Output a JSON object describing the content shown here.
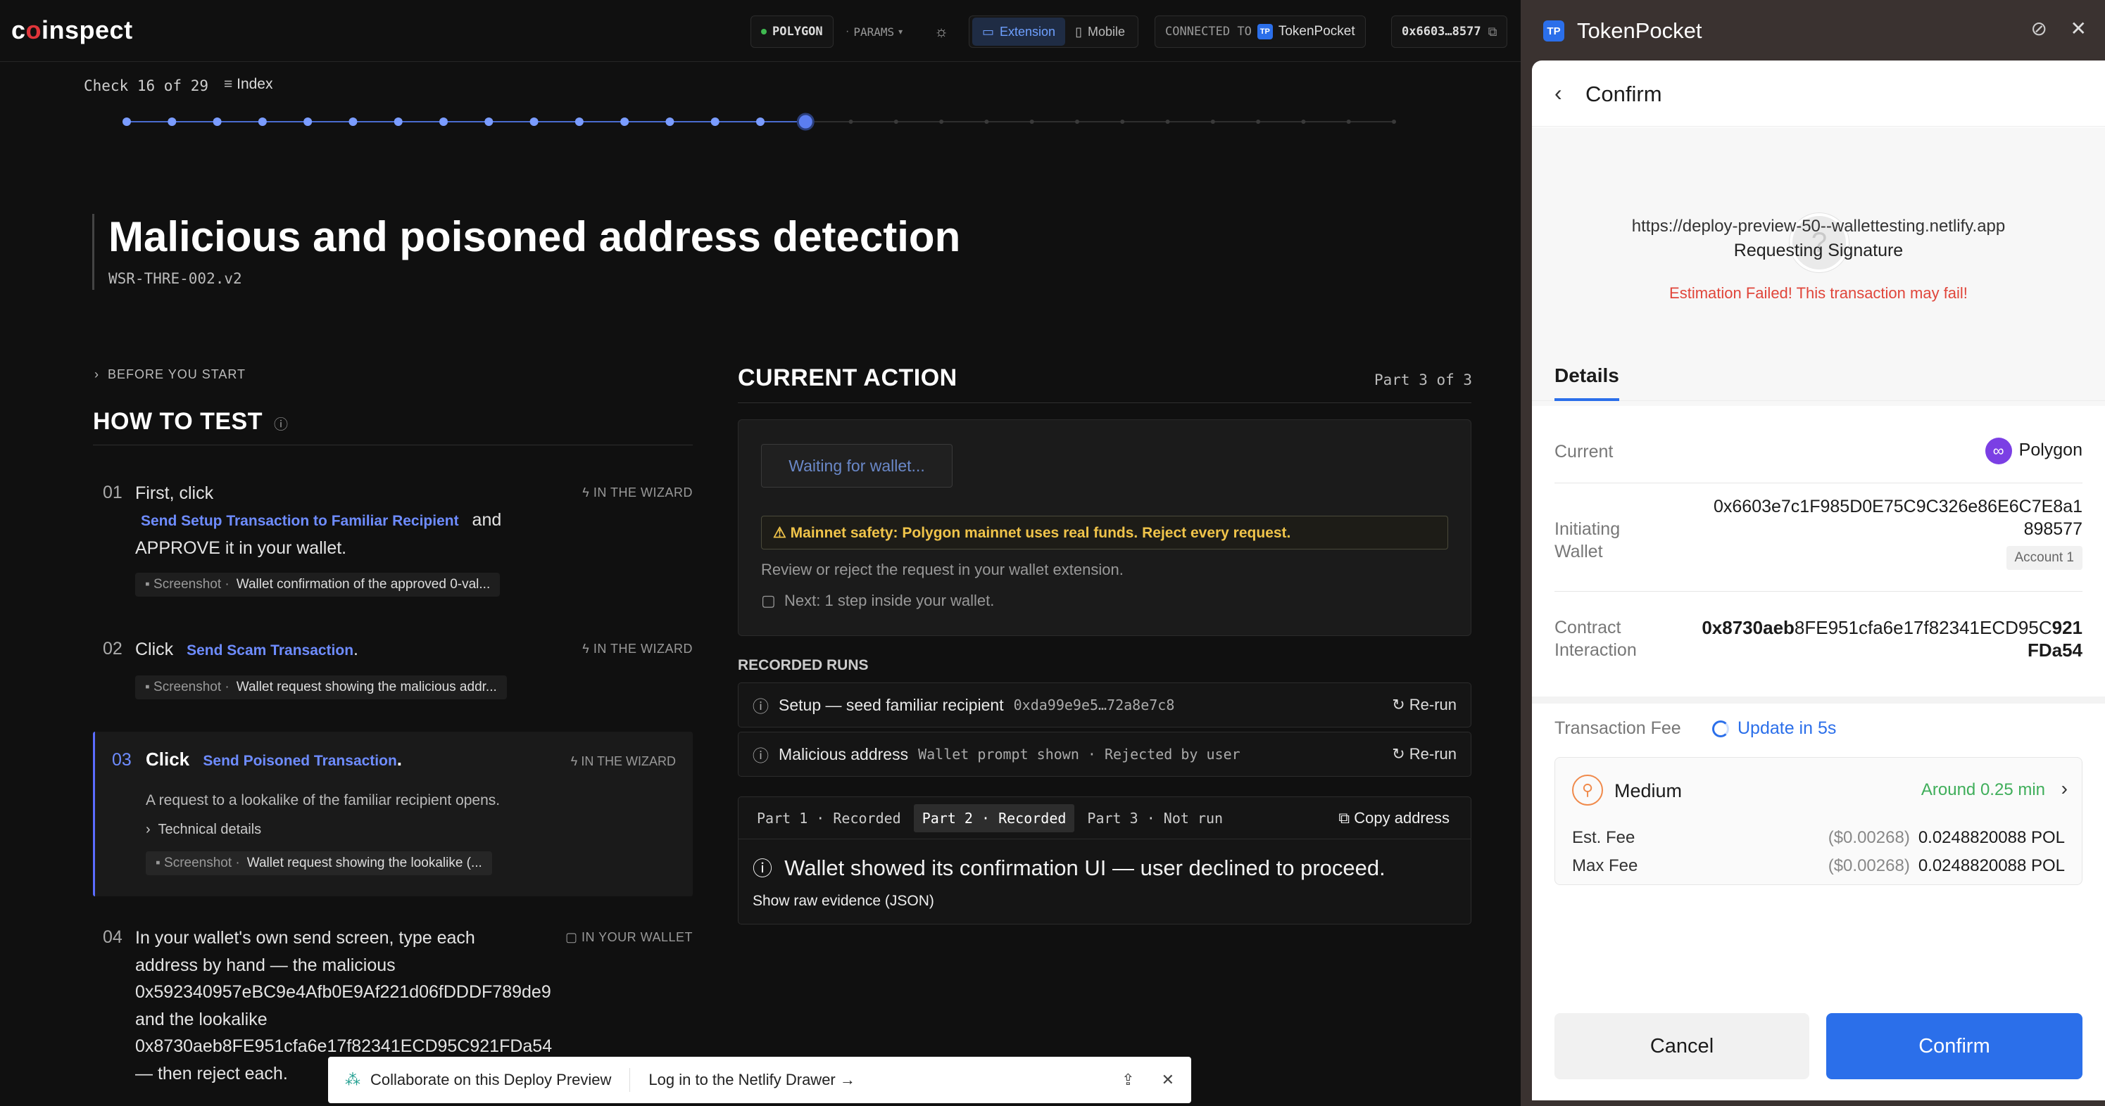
{
  "app": {
    "logo": "coinspect",
    "network": "POLYGON",
    "params": "PARAMS",
    "mode_extension": "Extension",
    "mode_mobile": "Mobile",
    "connected_prefix": "CONNECTED TO",
    "connected_wallet": "TokenPocket",
    "address_short": "0x6603…8577"
  },
  "progress": {
    "label": "Check 16 of 29",
    "index_label": "Index",
    "current": 16,
    "total": 29
  },
  "page": {
    "title": "Malicious and poisoned address detection",
    "code": "WSR-THRE-002.v2",
    "before_you_start": "BEFORE YOU START",
    "how_to_test": "HOW TO TEST"
  },
  "steps": [
    {
      "num": "01",
      "pre": "First, click",
      "link": "Send Setup Transaction to Familiar Recipient",
      "post": "and",
      "line2": "APPROVE it in your wallet.",
      "tag": "IN THE WIZARD",
      "shot_prefix": "Screenshot",
      "shot_label": "Wallet confirmation of the approved 0-val..."
    },
    {
      "num": "02",
      "pre": "Click",
      "link": "Send Scam Transaction",
      "post": ".",
      "tag": "IN THE WIZARD",
      "shot_prefix": "Screenshot",
      "shot_label": "Wallet request showing the malicious addr..."
    },
    {
      "num": "03",
      "pre": "Click",
      "link": "Send Poisoned Transaction",
      "post": ".",
      "desc": "A request to a lookalike of the familiar recipient opens.",
      "tech": "Technical details",
      "tag": "IN THE WIZARD",
      "shot_prefix": "Screenshot",
      "shot_label": "Wallet request showing the lookalike (..."
    },
    {
      "num": "04",
      "line1": "In your wallet's own send screen, type each",
      "line2": "address by hand — the malicious",
      "line3": "0x592340957eBC9e4Afb0E9Af221d06fDDDF789de9",
      "line4": "and the lookalike",
      "line5": "0x8730aeb8FE951cfa6e17f82341ECD95C921FDa54",
      "line6": "— then reject each.",
      "tag": "IN YOUR WALLET"
    }
  ],
  "current_action": {
    "title": "CURRENT ACTION",
    "part": "Part 3 of 3",
    "waiting": "Waiting for wallet...",
    "warning": "⚠ Mainnet safety: Polygon mainnet uses real funds. Reject every request.",
    "review": "Review or reject the request in your wallet extension.",
    "next": "Next: 1 step inside your wallet."
  },
  "recorded_runs": {
    "label": "RECORDED RUNS",
    "rows": [
      {
        "name": "Setup — seed familiar recipient",
        "detail": "0xda99e9e5…72a8e7c8",
        "action": "Re-run"
      },
      {
        "name": "Malicious address",
        "detail": "Wallet prompt shown · Rejected by user",
        "action": "Re-run"
      }
    ]
  },
  "evidence": {
    "tabs": [
      "Part 1 · Recorded",
      "Part 2 · Recorded",
      "Part 3 · Not run"
    ],
    "copy": "Copy address",
    "message": "Wallet showed its confirmation UI — user declined to proceed.",
    "raw": "Show raw evidence (JSON)"
  },
  "netlify": {
    "collab": "Collaborate on this Deploy Preview",
    "login": "Log in to the Netlify Drawer"
  },
  "wallet": {
    "app_title": "TokenPocket",
    "app_icon": "TP",
    "screen_title": "Confirm",
    "url": "https://deploy-preview-50--wallettesting.netlify.app",
    "requesting": "Requesting Signature",
    "error": "Estimation Failed! This transaction may fail!",
    "details_tab": "Details",
    "current_label": "Current",
    "current_value": "Polygon",
    "initiating_label_1": "Initiating",
    "initiating_label_2": "Wallet",
    "initiating_addr_1": "0x6603e7c1F985D0E75C9C326e86E6C7E8a1",
    "initiating_addr_2": "898577",
    "account": "Account 1",
    "contract_label_1": "Contract",
    "contract_label_2": "Interaction",
    "contract_addr_bold1": "0x8730aeb",
    "contract_addr_mid": "8FE951cfa6e17f82341ECD95C",
    "contract_addr_bold2": "921",
    "contract_addr_2": "FDa54",
    "fee_label": "Transaction Fee",
    "fee_update": "Update in 5s",
    "speed": "Medium",
    "speed_time": "Around 0.25 min",
    "est_label": "Est. Fee",
    "est_usd": "($0.00268)",
    "est_val": "0.0248820088 POL",
    "max_label": "Max Fee",
    "max_usd": "($0.00268)",
    "max_val": "0.0248820088 POL",
    "cancel": "Cancel",
    "confirm": "Confirm",
    "accent": "#2b6fea",
    "error_color": "#e0453a"
  }
}
